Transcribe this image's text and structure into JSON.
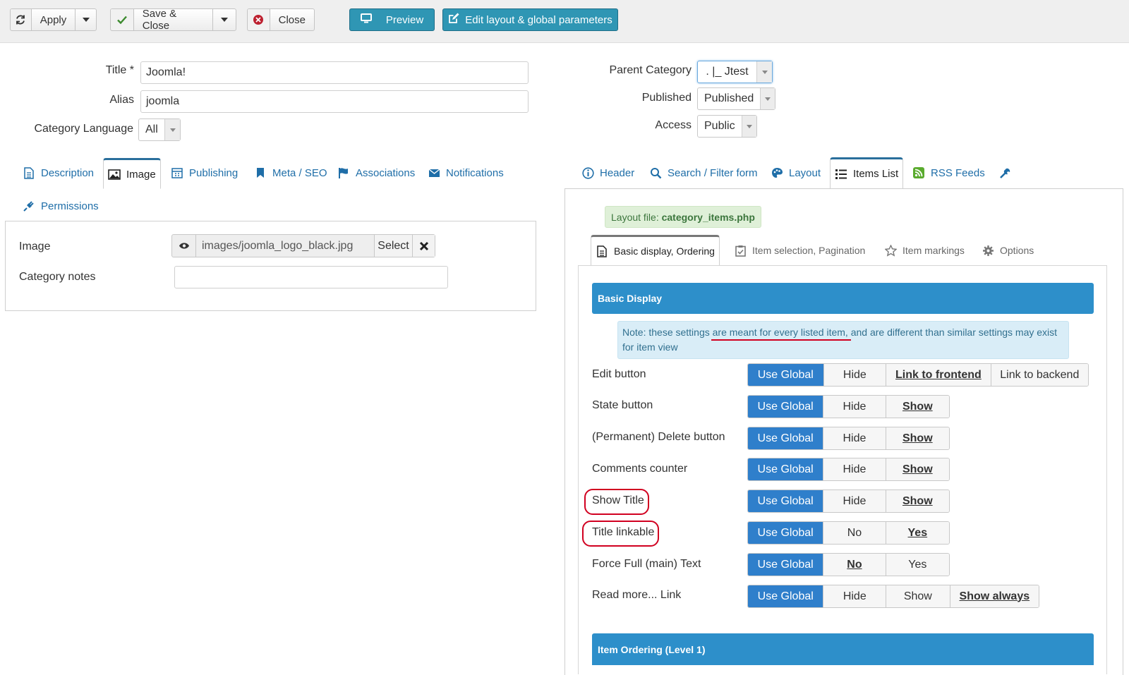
{
  "toolbar": {
    "apply": "Apply",
    "save_close": "Save & Close",
    "close": "Close",
    "preview": "Preview",
    "edit_layout": "Edit layout & global parameters"
  },
  "form": {
    "title_label": "Title *",
    "title_value": "Joomla!",
    "alias_label": "Alias",
    "alias_value": "joomla",
    "language_label": "Category Language",
    "language_value": "All",
    "parent_label": "Parent Category",
    "parent_value": ". |_ Jtest",
    "published_label": "Published",
    "published_value": "Published",
    "access_label": "Access",
    "access_value": "Public"
  },
  "left_tabs": [
    "Description",
    "Image",
    "Publishing",
    "Meta / SEO",
    "Associations",
    "Notifications",
    "Permissions"
  ],
  "image_panel": {
    "image_label": "Image",
    "image_path": "images/joomla_logo_black.jpg",
    "select": "Select",
    "notes_label": "Category notes",
    "notes_value": ""
  },
  "right_tabs": [
    "Header",
    "Search / Filter form",
    "Layout",
    "Items List",
    "RSS Feeds"
  ],
  "layout_file": {
    "prefix": "Layout file: ",
    "name": "category_items.php"
  },
  "sub_tabs": [
    "Basic display, Ordering",
    "Item selection, Pagination",
    "Item markings",
    "Options"
  ],
  "sections": {
    "basic_display": "Basic Display",
    "item_ordering": "Item Ordering (Level 1)"
  },
  "note": "Note: these settings are meant for every listed item, and are different than similar settings may exist for item view",
  "rows": [
    {
      "label": "Edit button",
      "options": [
        "Use Global",
        "Hide",
        "Link to frontend",
        "Link to backend"
      ]
    },
    {
      "label": "State button",
      "options": [
        "Use Global",
        "Hide",
        "Show"
      ]
    },
    {
      "label": "(Permanent) Delete button",
      "options": [
        "Use Global",
        "Hide",
        "Show"
      ]
    },
    {
      "label": "Comments counter",
      "options": [
        "Use Global",
        "Hide",
        "Show"
      ]
    },
    {
      "label": "Show Title",
      "options": [
        "Use Global",
        "Hide",
        "Show"
      ]
    },
    {
      "label": "Title linkable",
      "options": [
        "Use Global",
        "No",
        "Yes"
      ]
    },
    {
      "label": "Force Full (main) Text",
      "options": [
        "Use Global",
        "No",
        "Yes"
      ]
    },
    {
      "label": "Read more... Link",
      "options": [
        "Use Global",
        "Hide",
        "Show",
        "Show always"
      ]
    }
  ],
  "colors": {
    "accent_blue": "#2f96b4",
    "section_blue": "#2d8fca",
    "annotation_red": "#d10020"
  }
}
